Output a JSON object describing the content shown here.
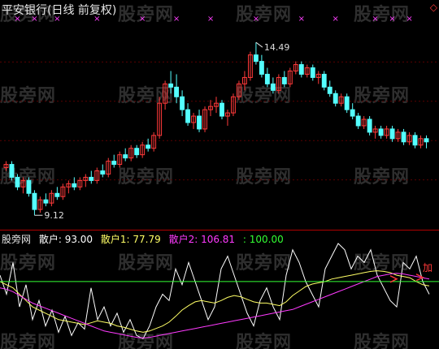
{
  "title": "平安银行(日线 前复权)",
  "corner_icon": "diamond-outline-icon",
  "watermark": "股旁网",
  "price_high_label": "14.49",
  "price_low_label": "9.12",
  "indicator": {
    "name": "股旁网",
    "s_label": "散户: 93.00",
    "s1_label": "散户1: 77.79",
    "s2_label": "散户2: 106.81",
    "s3_label": ": 100.00"
  },
  "signal_label": "加",
  "colors": {
    "up": "#ff3a3a",
    "down": "#54ffff",
    "marker": "#ff40ff",
    "line_white": "#ffffff",
    "line_yellow": "#ffff66",
    "line_magenta": "#ff3aff",
    "line_green": "#33ff33",
    "separator": "#b00000"
  },
  "chart_data": {
    "type": "candlestick",
    "ylim": [
      9.0,
      15.1
    ],
    "candles": [
      [
        10.6,
        10.8,
        10.5,
        10.7
      ],
      [
        10.7,
        10.8,
        10.2,
        10.3
      ],
      [
        10.3,
        10.4,
        9.9,
        10.0
      ],
      [
        10.0,
        10.3,
        9.8,
        10.2
      ],
      [
        10.2,
        10.3,
        9.7,
        9.8
      ],
      [
        9.8,
        9.9,
        9.12,
        9.3
      ],
      [
        9.3,
        9.7,
        9.2,
        9.6
      ],
      [
        9.6,
        9.8,
        9.4,
        9.5
      ],
      [
        9.5,
        9.9,
        9.4,
        9.8
      ],
      [
        9.8,
        10.0,
        9.6,
        9.7
      ],
      [
        9.7,
        10.1,
        9.6,
        10.0
      ],
      [
        10.0,
        10.2,
        9.8,
        10.1
      ],
      [
        10.1,
        10.3,
        9.9,
        10.0
      ],
      [
        10.0,
        10.3,
        9.9,
        10.2
      ],
      [
        10.2,
        10.4,
        10.0,
        10.3
      ],
      [
        10.3,
        10.5,
        10.1,
        10.2
      ],
      [
        10.2,
        10.6,
        10.1,
        10.5
      ],
      [
        10.5,
        10.7,
        10.3,
        10.4
      ],
      [
        10.4,
        10.9,
        10.3,
        10.8
      ],
      [
        10.8,
        11.0,
        10.6,
        10.7
      ],
      [
        10.7,
        11.1,
        10.6,
        11.0
      ],
      [
        11.0,
        11.2,
        10.8,
        10.9
      ],
      [
        10.9,
        11.3,
        10.8,
        11.2
      ],
      [
        11.2,
        11.3,
        10.9,
        11.0
      ],
      [
        11.0,
        11.4,
        10.9,
        11.3
      ],
      [
        11.3,
        11.5,
        11.1,
        11.2
      ],
      [
        11.2,
        11.7,
        11.1,
        11.6
      ],
      [
        11.6,
        12.8,
        11.5,
        12.6
      ],
      [
        12.6,
        13.3,
        12.4,
        13.2
      ],
      [
        13.2,
        13.6,
        12.9,
        13.1
      ],
      [
        13.1,
        13.5,
        12.6,
        12.8
      ],
      [
        12.8,
        13.0,
        12.2,
        12.4
      ],
      [
        12.4,
        12.6,
        11.9,
        12.0
      ],
      [
        12.0,
        12.3,
        11.8,
        12.2
      ],
      [
        12.2,
        12.4,
        11.7,
        11.8
      ],
      [
        11.8,
        12.5,
        11.7,
        12.4
      ],
      [
        12.4,
        12.7,
        12.2,
        12.5
      ],
      [
        12.5,
        12.8,
        12.3,
        12.6
      ],
      [
        12.6,
        12.7,
        12.1,
        12.2
      ],
      [
        12.2,
        12.4,
        11.9,
        12.3
      ],
      [
        12.3,
        12.9,
        12.2,
        12.8
      ],
      [
        12.8,
        13.3,
        12.7,
        13.2
      ],
      [
        13.2,
        13.6,
        13.0,
        13.4
      ],
      [
        13.4,
        14.2,
        13.3,
        14.1
      ],
      [
        14.1,
        14.49,
        13.8,
        13.9
      ],
      [
        13.9,
        14.1,
        13.4,
        13.5
      ],
      [
        13.5,
        13.7,
        13.1,
        13.2
      ],
      [
        13.2,
        13.4,
        12.9,
        13.0
      ],
      [
        13.0,
        13.5,
        12.9,
        13.4
      ],
      [
        13.4,
        13.6,
        13.1,
        13.2
      ],
      [
        13.2,
        13.7,
        13.1,
        13.6
      ],
      [
        13.6,
        13.9,
        13.5,
        13.8
      ],
      [
        13.8,
        13.9,
        13.4,
        13.5
      ],
      [
        13.5,
        13.8,
        13.4,
        13.7
      ],
      [
        13.7,
        13.8,
        13.3,
        13.4
      ],
      [
        13.4,
        13.6,
        13.2,
        13.5
      ],
      [
        13.5,
        13.6,
        13.0,
        13.1
      ],
      [
        13.1,
        13.3,
        12.8,
        12.9
      ],
      [
        12.9,
        13.0,
        12.5,
        12.6
      ],
      [
        12.6,
        12.9,
        12.5,
        12.8
      ],
      [
        12.8,
        12.9,
        12.3,
        12.4
      ],
      [
        12.4,
        12.6,
        12.1,
        12.2
      ],
      [
        12.2,
        12.3,
        11.8,
        11.9
      ],
      [
        11.9,
        12.2,
        11.8,
        12.1
      ],
      [
        12.1,
        12.2,
        11.6,
        11.7
      ],
      [
        11.7,
        11.9,
        11.5,
        11.8
      ],
      [
        11.8,
        11.9,
        11.5,
        11.6
      ],
      [
        11.6,
        11.9,
        11.5,
        11.8
      ],
      [
        11.8,
        11.9,
        11.4,
        11.5
      ],
      [
        11.5,
        11.8,
        11.4,
        11.7
      ],
      [
        11.7,
        11.8,
        11.3,
        11.4
      ],
      [
        11.4,
        11.7,
        11.3,
        11.6
      ],
      [
        11.6,
        11.7,
        11.2,
        11.3
      ],
      [
        11.3,
        11.6,
        11.2,
        11.5
      ],
      [
        11.5,
        11.6,
        11.2,
        11.4
      ]
    ],
    "markers": [
      2,
      5,
      9,
      16,
      24,
      30,
      36,
      44,
      52,
      58,
      65,
      68,
      71
    ],
    "indicator_ylim": [
      0,
      160
    ],
    "series": [
      {
        "name": "散户",
        "values": [
          110,
          80,
          130,
          60,
          95,
          40,
          70,
          30,
          55,
          20,
          45,
          15,
          35,
          25,
          90,
          40,
          60,
          30,
          50,
          20,
          40,
          15,
          10,
          30,
          60,
          80,
          70,
          120,
          95,
          130,
          100,
          70,
          40,
          60,
          120,
          140,
          110,
          80,
          50,
          30,
          70,
          90,
          60,
          40,
          110,
          150,
          130,
          100,
          80,
          60,
          120,
          140,
          160,
          150,
          120,
          140,
          130,
          150,
          110,
          90,
          70,
          60,
          130,
          120,
          140,
          100,
          80
        ]
      },
      {
        "name": "散户1",
        "values": [
          100,
          95,
          90,
          80,
          70,
          60,
          55,
          50,
          45,
          40,
          38,
          36,
          34,
          32,
          35,
          38,
          36,
          34,
          30,
          28,
          25,
          22,
          20,
          22,
          26,
          30,
          36,
          45,
          55,
          62,
          68,
          70,
          68,
          66,
          70,
          75,
          78,
          76,
          72,
          68,
          66,
          66,
          64,
          62,
          68,
          78,
          85,
          92,
          96,
          98,
          100,
          104,
          106,
          108,
          110,
          112,
          114,
          116,
          117,
          116,
          114,
          110,
          108,
          106,
          100,
          95,
          93
        ]
      },
      {
        "name": "散户2",
        "values": [
          90,
          88,
          84,
          78,
          72,
          66,
          62,
          58,
          54,
          50,
          46,
          42,
          38,
          34,
          30,
          26,
          22,
          20,
          18,
          16,
          14,
          12,
          11,
          12,
          14,
          16,
          18,
          20,
          22,
          24,
          26,
          28,
          30,
          32,
          34,
          36,
          38,
          40,
          42,
          44,
          46,
          48,
          50,
          52,
          54,
          56,
          60,
          64,
          68,
          72,
          76,
          80,
          84,
          88,
          92,
          96,
          100,
          104,
          108,
          110,
          112,
          113,
          112,
          110,
          108,
          106,
          104
        ]
      },
      {
        "name": "",
        "values": [
          100
        ]
      }
    ]
  }
}
